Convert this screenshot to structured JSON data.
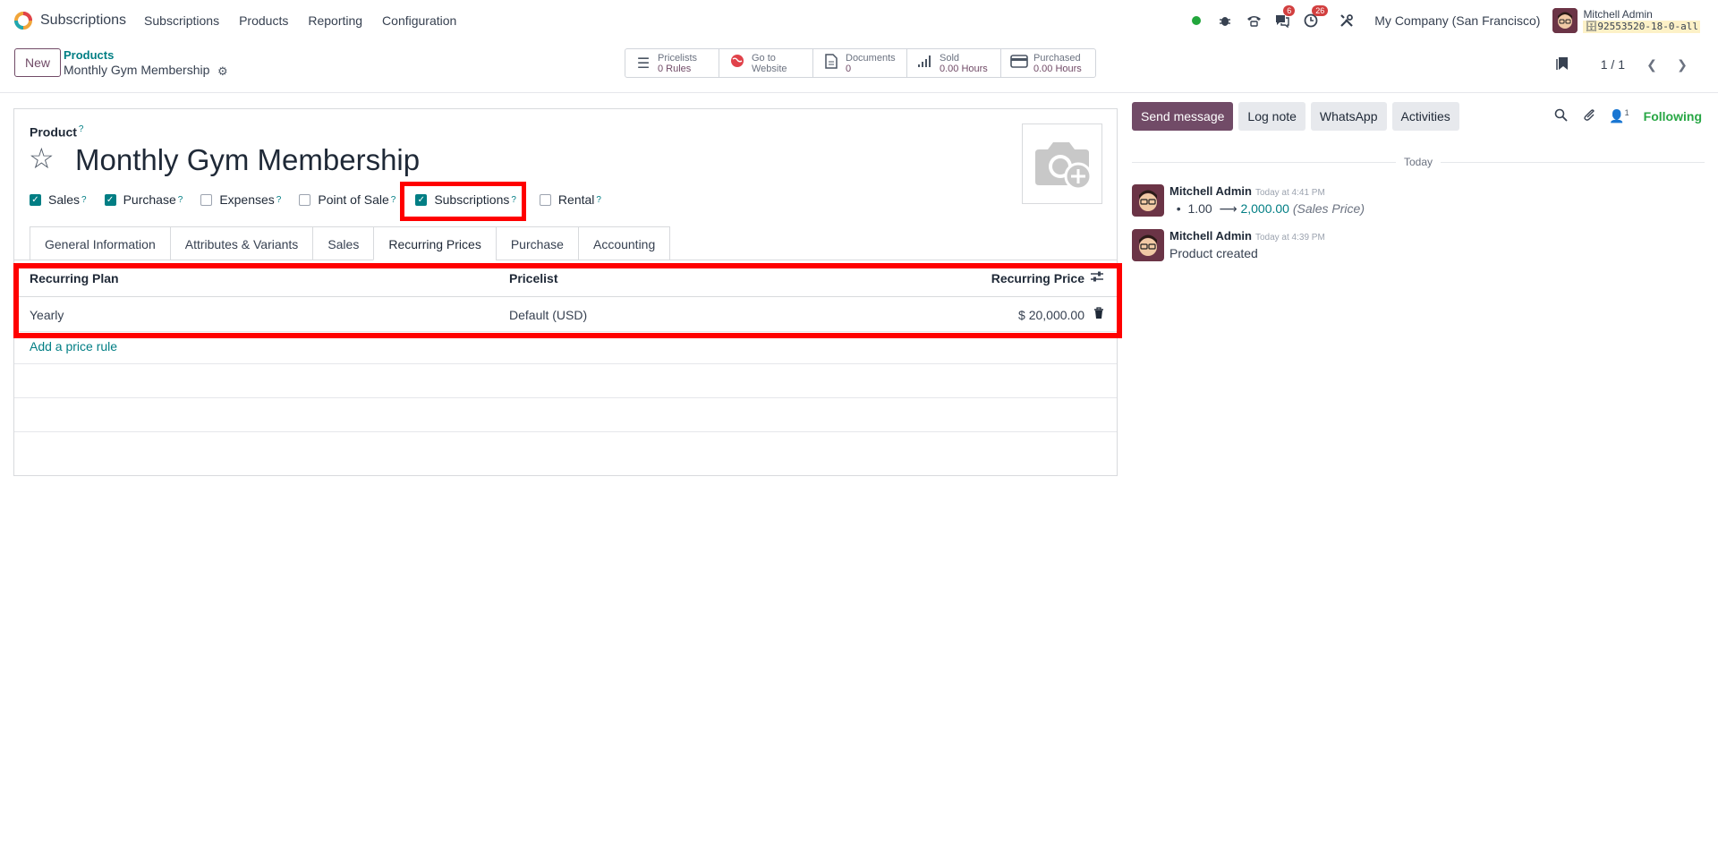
{
  "navbar": {
    "app_name": "Subscriptions",
    "menu": [
      "Subscriptions",
      "Products",
      "Reporting",
      "Configuration"
    ],
    "messages_badge": "6",
    "activities_badge": "26",
    "company": "My Company (San Francisco)",
    "user_name": "Mitchell Admin",
    "database": "92553520-18-0-all"
  },
  "control": {
    "new_label": "New",
    "breadcrumb_parent": "Products",
    "breadcrumb_current": "Monthly Gym Membership",
    "stats": [
      {
        "label": "Pricelists",
        "value": "0 Rules",
        "icon": "list-icon"
      },
      {
        "label": "Go to",
        "value": "Website",
        "icon": "globe-icon"
      },
      {
        "label": "Documents",
        "value": "0",
        "icon": "document-icon"
      },
      {
        "label": "Sold",
        "value": "0.00 Hours",
        "icon": "bar-chart-icon"
      },
      {
        "label": "Purchased",
        "value": "0.00 Hours",
        "icon": "credit-card-icon"
      }
    ],
    "pager": "1 / 1"
  },
  "form": {
    "product_label": "Product",
    "help_mark": "?",
    "product_name": "Monthly Gym Membership",
    "checkboxes": [
      {
        "label": "Sales",
        "checked": true
      },
      {
        "label": "Purchase",
        "checked": true
      },
      {
        "label": "Expenses",
        "checked": false
      },
      {
        "label": "Point of Sale",
        "checked": false
      },
      {
        "label": "Subscriptions",
        "checked": true
      },
      {
        "label": "Rental",
        "checked": false
      }
    ],
    "tabs": [
      "General Information",
      "Attributes & Variants",
      "Sales",
      "Recurring Prices",
      "Purchase",
      "Accounting"
    ],
    "active_tab": "Recurring Prices",
    "table": {
      "headers": [
        "Recurring Plan",
        "Pricelist",
        "Recurring Price"
      ],
      "rows": [
        {
          "plan": "Yearly",
          "pricelist": "Default (USD)",
          "price": "$ 20,000.00"
        }
      ],
      "add_label": "Add a price rule"
    }
  },
  "chatter": {
    "buttons": [
      "Send message",
      "Log note",
      "WhatsApp",
      "Activities"
    ],
    "followers_count": "1",
    "following_label": "Following",
    "date_separator": "Today",
    "messages": [
      {
        "author": "Mitchell Admin",
        "time": "Today at 4:41 PM",
        "old_value": "1.00",
        "arrow": "⟶",
        "new_value": "2,000.00",
        "field": "(Sales Price)"
      },
      {
        "author": "Mitchell Admin",
        "time": "Today at 4:39 PM",
        "body": "Product created"
      }
    ]
  },
  "colors": {
    "brand": "#714b67",
    "accent": "#017e84",
    "highlight": "#ff0000",
    "following": "#28a745"
  }
}
